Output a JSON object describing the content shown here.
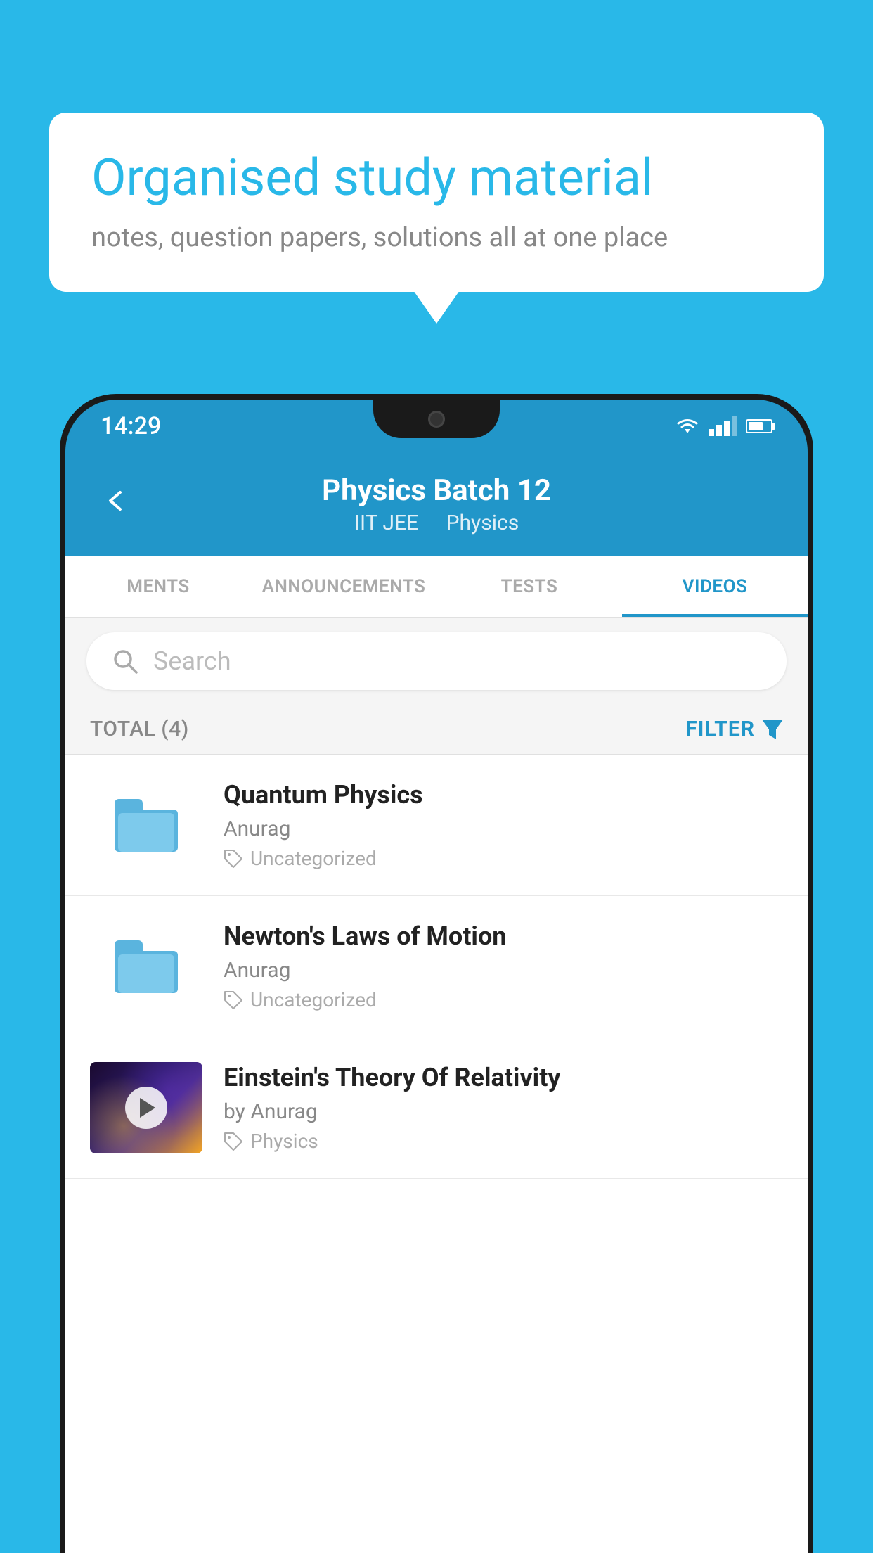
{
  "background_color": "#29b8e8",
  "speech_bubble": {
    "title": "Organised study material",
    "subtitle": "notes, question papers, solutions all at one place"
  },
  "status_bar": {
    "time": "14:29"
  },
  "header": {
    "title": "Physics Batch 12",
    "subtitle_part1": "IIT JEE",
    "subtitle_part2": "Physics",
    "back_label": "←"
  },
  "tabs": [
    {
      "label": "MENTS",
      "active": false
    },
    {
      "label": "ANNOUNCEMENTS",
      "active": false
    },
    {
      "label": "TESTS",
      "active": false
    },
    {
      "label": "VIDEOS",
      "active": true
    }
  ],
  "search": {
    "placeholder": "Search"
  },
  "filter": {
    "total_label": "TOTAL (4)",
    "filter_label": "FILTER"
  },
  "videos": [
    {
      "title": "Quantum Physics",
      "author": "Anurag",
      "tag": "Uncategorized",
      "type": "folder"
    },
    {
      "title": "Newton's Laws of Motion",
      "author": "Anurag",
      "tag": "Uncategorized",
      "type": "folder"
    },
    {
      "title": "Einstein's Theory Of Relativity",
      "author": "by Anurag",
      "tag": "Physics",
      "type": "video"
    }
  ]
}
